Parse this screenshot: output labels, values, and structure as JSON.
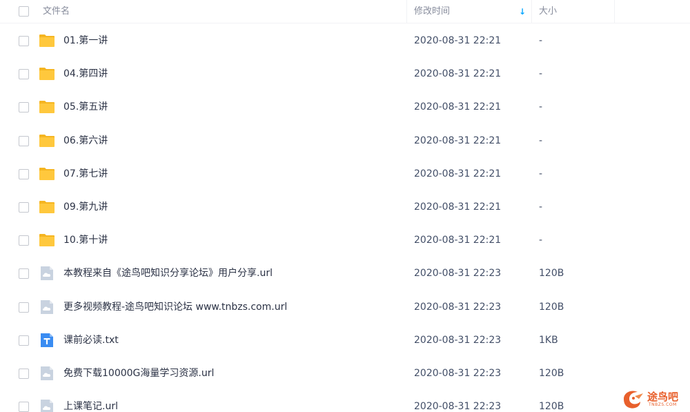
{
  "header": {
    "name_label": "文件名",
    "mtime_label": "修改时间",
    "size_label": "大小",
    "sort_indicator": "↓"
  },
  "files": [
    {
      "name": "01.第一讲",
      "mtime": "2020-08-31 22:21",
      "size": "-",
      "icon": "folder-icon"
    },
    {
      "name": "04.第四讲",
      "mtime": "2020-08-31 22:21",
      "size": "-",
      "icon": "folder-icon"
    },
    {
      "name": "05.第五讲",
      "mtime": "2020-08-31 22:21",
      "size": "-",
      "icon": "folder-icon"
    },
    {
      "name": "06.第六讲",
      "mtime": "2020-08-31 22:21",
      "size": "-",
      "icon": "folder-icon"
    },
    {
      "name": "07.第七讲",
      "mtime": "2020-08-31 22:21",
      "size": "-",
      "icon": "folder-icon"
    },
    {
      "name": "09.第九讲",
      "mtime": "2020-08-31 22:21",
      "size": "-",
      "icon": "folder-icon"
    },
    {
      "name": "10.第十讲",
      "mtime": "2020-08-31 22:21",
      "size": "-",
      "icon": "folder-icon"
    },
    {
      "name": "本教程来自《途鸟吧知识分享论坛》用户分享.url",
      "mtime": "2020-08-31 22:23",
      "size": "120B",
      "icon": "url-file-icon"
    },
    {
      "name": "更多视频教程-途鸟吧知识论坛 www.tnbzs.com.url",
      "mtime": "2020-08-31 22:23",
      "size": "120B",
      "icon": "url-file-icon"
    },
    {
      "name": "课前必读.txt",
      "mtime": "2020-08-31 22:23",
      "size": "1KB",
      "icon": "txt-file-icon"
    },
    {
      "name": "免费下载10000G海量学习资源.url",
      "mtime": "2020-08-31 22:23",
      "size": "120B",
      "icon": "url-file-icon"
    },
    {
      "name": "上课笔记.url",
      "mtime": "2020-08-31 22:23",
      "size": "120B",
      "icon": "url-file-icon"
    }
  ],
  "watermark": {
    "text": "途鸟吧",
    "subtext": "TNBZS.COM"
  },
  "colors": {
    "folder": "#ffc83d",
    "folder_back": "#f5b521",
    "url_file": "#c9d3e0",
    "txt_file": "#3a8cf2",
    "sort_accent": "#06a7ff",
    "watermark": "#e8602c"
  }
}
